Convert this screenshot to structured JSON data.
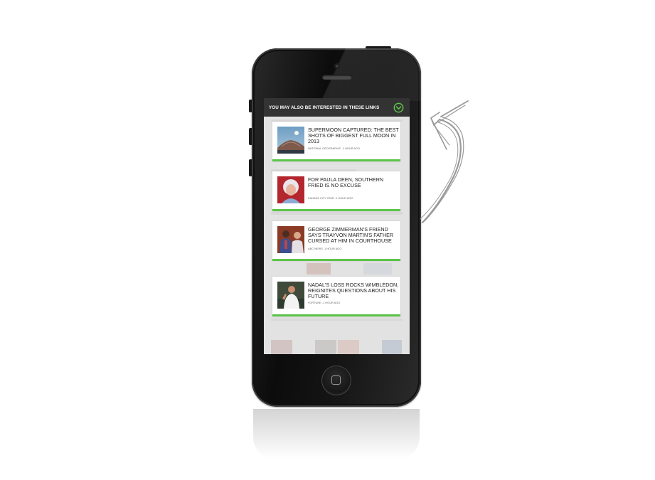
{
  "overlay": {
    "title": "YOU MAY ALSO BE INTERESTED IN THESE LINKS",
    "toggle_icon": "chevron-down-circle-icon",
    "accent_color": "#5cc449",
    "header_color": "#333333"
  },
  "articles": [
    {
      "title": "SUPERMOON CAPTURED: THE BEST SHOTS OF BIGGEST FULL MOON IN 2013",
      "meta": "NATIONAL GEOGRAPHIC -1 HOUR AGO",
      "thumb_icon": "moon-photo-thumbnail"
    },
    {
      "title": "FOR PAULA DEEN, SOUTHERN FRIED IS NO EXCUSE",
      "meta": "KANSAS CITY STAR -1 HOUR AGO",
      "thumb_icon": "portrait-photo-thumbnail"
    },
    {
      "title": "GEORGE ZIMMERMAN'S FRIEND SAYS TRAYVON MARTIN'S FATHER CURSED AT HIM IN COURTHOUSE",
      "meta": "ABC NEWS -1 HOUR AGO",
      "thumb_icon": "people-photo-thumbnail"
    },
    {
      "title": "NADAL'S LOSS ROCKS WIMBLEDON, REIGNITES QUESTIONS ABOUT HIS FUTURE",
      "meta": "FORTUNE -1 HOUR AGO",
      "thumb_icon": "tennis-player-photo-thumbnail"
    }
  ]
}
